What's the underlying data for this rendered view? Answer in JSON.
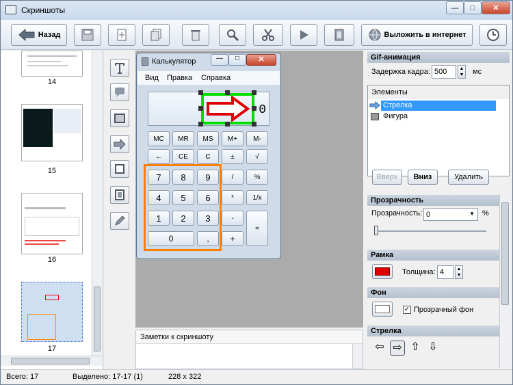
{
  "window": {
    "title": "Скриншоты",
    "min": "—",
    "max": "□",
    "close": "✕"
  },
  "toolbar": {
    "back": "Назад",
    "upload": "Выложить в интернет"
  },
  "thumbnails": [
    {
      "label": "14"
    },
    {
      "label": "15"
    },
    {
      "label": "16"
    },
    {
      "label": "17"
    }
  ],
  "calc": {
    "title": "Калькулятор",
    "menu": [
      "Вид",
      "Правка",
      "Справка"
    ],
    "display": "0",
    "row1": [
      "MC",
      "MR",
      "MS",
      "M+",
      "M-"
    ],
    "row2": [
      "←",
      "CE",
      "C",
      "±",
      "√"
    ],
    "row3": [
      "7",
      "8",
      "9",
      "/",
      "%"
    ],
    "row4": [
      "4",
      "5",
      "6",
      "*",
      "1/x"
    ],
    "row5": [
      "1",
      "2",
      "3",
      "-",
      "="
    ],
    "row6": [
      "0",
      ",",
      "+"
    ]
  },
  "notes": {
    "label": "Заметки к скриншоту"
  },
  "gif": {
    "title": "Gif-анимация",
    "delay_label": "Задержка кадра:",
    "delay_value": "500",
    "delay_unit": "мс",
    "elements_header": "Элементы",
    "elements": [
      {
        "label": "Стрелка",
        "selected": true
      },
      {
        "label": "Фигура",
        "selected": false
      }
    ],
    "up": "Вверх",
    "down": "Вниз",
    "delete": "Удалить"
  },
  "transparency": {
    "title": "Прозрачность",
    "label": "Прозрачность:",
    "value": "0",
    "unit": "%"
  },
  "frame": {
    "title": "Рамка",
    "thickness_label": "Толщина:",
    "thickness_value": "4",
    "color": "#e00000"
  },
  "background": {
    "title": "Фон",
    "checkbox_label": "Прозрачный фон",
    "checked": true
  },
  "arrow": {
    "title": "Стрелка"
  },
  "status": {
    "total": "Всего: 17",
    "selected": "Выделено: 17-17 (1)",
    "size": "228 x 322"
  },
  "colors": {
    "selection": "#3399ff",
    "highlight_box": "#ff8000",
    "green_box": "#00dd00",
    "arrow": "#e00000"
  }
}
